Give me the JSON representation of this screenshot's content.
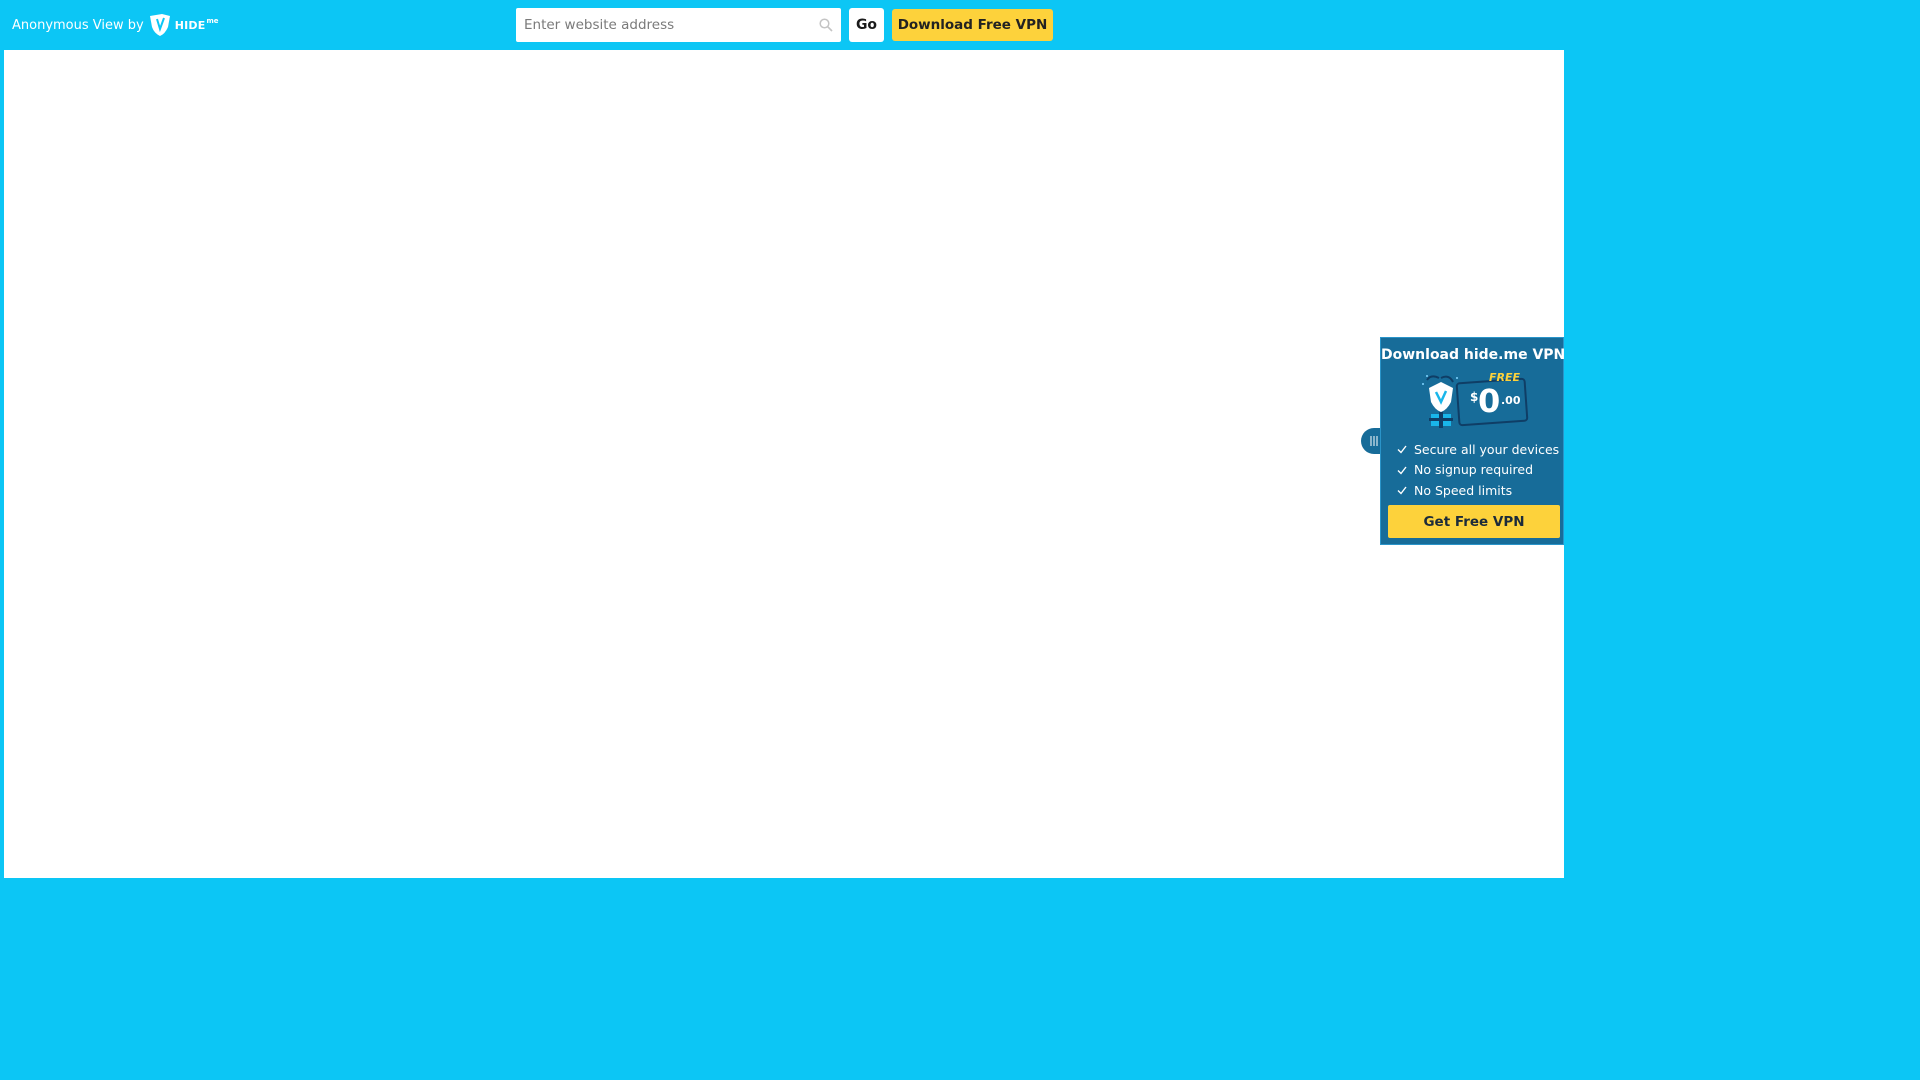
{
  "header": {
    "brand_text": "Anonymous View by",
    "logo_word": "HIDE",
    "logo_sup": "me",
    "search": {
      "placeholder": "Enter website address",
      "value": ""
    },
    "go_label": "Go",
    "download_label": "Download Free VPN"
  },
  "promo": {
    "title": "Download hide.me VPN",
    "free_label": "FREE",
    "price_currency": "$",
    "price_integer": "0",
    "price_decimal": ".00",
    "features": [
      "Secure all your devices",
      "No signup required",
      "No Speed limits"
    ],
    "cta_label": "Get Free VPN"
  },
  "icons": {
    "search": "search-icon",
    "logo": "hideme-logo-icon",
    "check": "check-icon",
    "grip": "grip-icon",
    "shield": "shield-gift-icon"
  },
  "colors": {
    "header_bg": "#0cc6f5",
    "accent_yellow": "#fdd23b",
    "promo_bg": "#176c99"
  }
}
